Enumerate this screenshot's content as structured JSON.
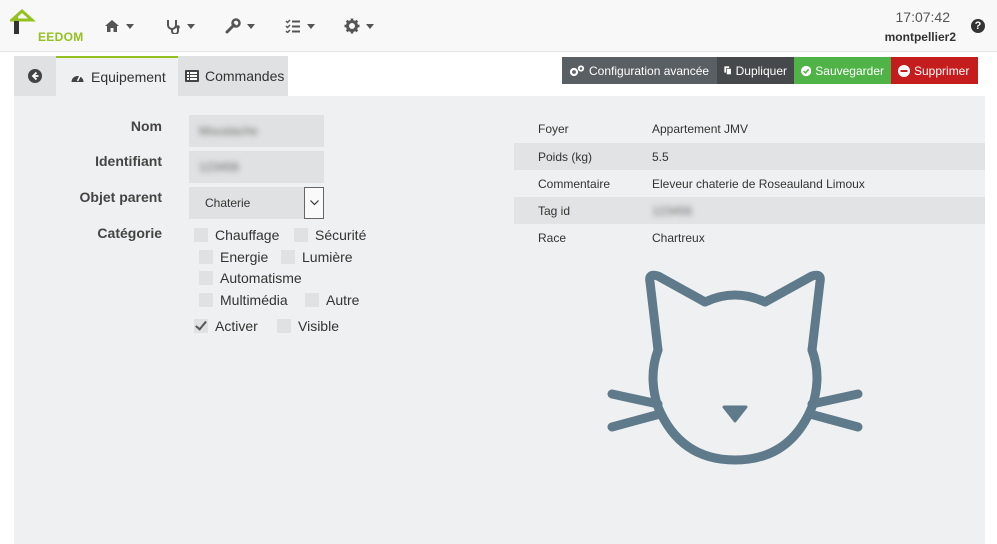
{
  "app": {
    "logo_text": "EEDOM"
  },
  "nav": {
    "items": [
      {
        "icon": "home-icon"
      },
      {
        "icon": "stethoscope-icon"
      },
      {
        "icon": "wrench-icon"
      },
      {
        "icon": "tasks-icon"
      },
      {
        "icon": "gear-icon"
      }
    ],
    "time": "17:07:42",
    "hostname": "montpellier2",
    "help": "?"
  },
  "tabs": [
    {
      "label": "Equipement"
    },
    {
      "label": "Commandes"
    }
  ],
  "actions": {
    "config_label": "Configuration avancée",
    "duplicate_label": "Dupliquer",
    "save_label": "Sauvegarder",
    "delete_label": "Supprimer"
  },
  "form": {
    "name_label": "Nom",
    "name_value": "Moustache",
    "id_label": "Identifiant",
    "id_value": "123456",
    "parent_label": "Objet parent",
    "parent_value": "Chaterie",
    "category_label": "Catégorie",
    "categories": [
      {
        "label": "Chauffage",
        "checked": false
      },
      {
        "label": "Sécurité",
        "checked": false
      },
      {
        "label": "Energie",
        "checked": false
      },
      {
        "label": "Lumière",
        "checked": false
      },
      {
        "label": "Automatisme",
        "checked": false
      },
      {
        "label": "Multimédia",
        "checked": false
      },
      {
        "label": "Autre",
        "checked": false
      }
    ],
    "activate_label": "Activer",
    "activate_checked": true,
    "visible_label": "Visible",
    "visible_checked": false
  },
  "info": [
    {
      "key": "Foyer",
      "value": "Appartement JMV"
    },
    {
      "key": "Poids (kg)",
      "value": "5.5"
    },
    {
      "key": "Commentaire",
      "value": "Eleveur chaterie de Roseauland Limoux"
    },
    {
      "key": "Tag id",
      "value": "123456"
    },
    {
      "key": "Race",
      "value": "Chartreux"
    }
  ],
  "illustration": {
    "icon": "cat-face-icon",
    "color": "#5f7a8a"
  },
  "colors": {
    "brand": "#94c11f",
    "save": "#4fb348",
    "delete": "#c51d1d",
    "config": "#5a5f63",
    "duplicate": "#45494c"
  }
}
